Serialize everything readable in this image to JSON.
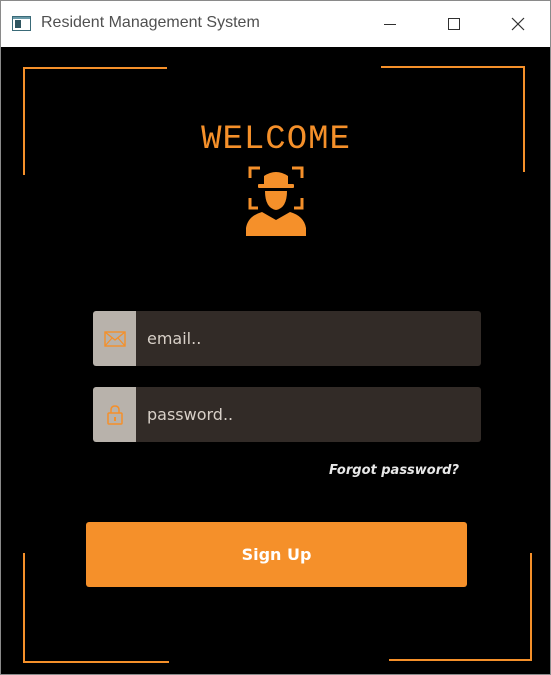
{
  "window": {
    "title": "Resident Management System",
    "controls": {
      "minimize": "minimize-icon",
      "maximize": "maximize-icon",
      "close": "close-icon"
    }
  },
  "login": {
    "heading": "WELCOME",
    "avatar_icon": "face-recognition-icon",
    "email": {
      "icon": "envelope-icon",
      "placeholder": "email..",
      "value": ""
    },
    "password": {
      "icon": "lock-icon",
      "placeholder": "password..",
      "value": ""
    },
    "forgot_label": "Forgot password?",
    "submit_label": "Sign Up"
  },
  "colors": {
    "accent": "#f5902a",
    "background": "#000000",
    "input_bg": "#322b27",
    "icon_bg": "#b8b2ab"
  }
}
